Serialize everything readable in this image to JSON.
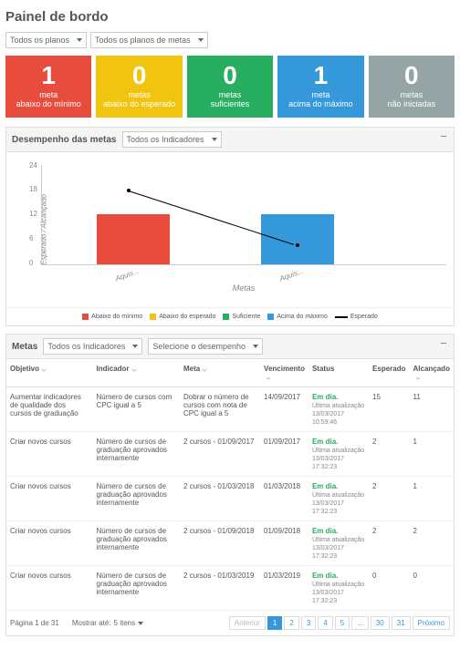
{
  "page_title": "Painel de bordo",
  "top_selects": {
    "plans": "Todos os planos",
    "goal_plans": "Todos os planos de metas"
  },
  "cards": [
    {
      "value": "1",
      "line1": "meta",
      "line2": "abaixo do mínimo",
      "color": "c-red"
    },
    {
      "value": "0",
      "line1": "metas",
      "line2": "abaixo do esperado",
      "color": "c-yellow"
    },
    {
      "value": "0",
      "line1": "metas",
      "line2": "suficientes",
      "color": "c-green"
    },
    {
      "value": "1",
      "line1": "meta",
      "line2": "acima do máximo",
      "color": "c-blue"
    },
    {
      "value": "0",
      "line1": "metas",
      "line2": "não iniciadas",
      "color": "c-gray"
    }
  ],
  "perf_panel": {
    "title": "Desempenho das metas",
    "select": "Todos os Indicadores",
    "y_axis_label": "Esperado / Alcançado",
    "x_axis_label": "Metas",
    "x_cat1": "Aquis...",
    "x_cat2": "Aquis...",
    "legend": {
      "below_min": "Abaixo do mínimo",
      "below_exp": "Abaixo do esperado",
      "sufficient": "Suficiente",
      "above_max": "Acima do máximo",
      "expected": "Esperado"
    }
  },
  "chart_data": {
    "type": "bar",
    "categories": [
      "Aquis...",
      "Aquis..."
    ],
    "series": [
      {
        "name": "Abaixo do mínimo",
        "values": [
          11,
          0
        ],
        "color": "#E74C3C"
      },
      {
        "name": "Abaixo do esperado",
        "values": [
          0,
          0
        ],
        "color": "#F1C40F"
      },
      {
        "name": "Suficiente",
        "values": [
          0,
          0
        ],
        "color": "#27AE60"
      },
      {
        "name": "Acima do máximo",
        "values": [
          0,
          11
        ],
        "color": "#3498DB"
      }
    ],
    "expected_line": {
      "name": "Esperado",
      "values": [
        17,
        4
      ]
    },
    "ylabel": "Esperado / Alcançado",
    "xlabel": "Metas",
    "ylim": [
      0,
      24
    ],
    "yticks": [
      0,
      6,
      12,
      18,
      24
    ]
  },
  "metas_panel": {
    "title": "Metas",
    "sel1": "Todos os Indicadores",
    "sel2": "Selecione o desempenho",
    "columns": {
      "objetivo": "Objetivo",
      "indicador": "Indicador",
      "meta": "Meta",
      "vencimento": "Vencimento",
      "status": "Status",
      "esperado": "Esperado",
      "alcancado": "Alcançado"
    },
    "rows": [
      {
        "objetivo": "Aumentar indicadores de qualidade dos cursos de graduação",
        "indicador": "Número de cursos com CPC igual a 5",
        "meta": "Dobrar o número de cursos com nota de CPC igual a 5",
        "vencimento": "14/09/2017",
        "status": "Em dia.",
        "status_sub": "Última atualização 13/03/2017 10:59:46",
        "esperado": "15",
        "alcancado": "11"
      },
      {
        "objetivo": "Criar novos cursos",
        "indicador": "Número de cursos de graduação aprovados internamente",
        "meta": "2 cursos - 01/09/2017",
        "vencimento": "01/09/2017",
        "status": "Em dia.",
        "status_sub": "Última atualização 13/03/2017 17:32:23",
        "esperado": "2",
        "alcancado": "1"
      },
      {
        "objetivo": "Criar novos cursos",
        "indicador": "Número de cursos de graduação aprovados internamente",
        "meta": "2 cursos - 01/03/2018",
        "vencimento": "01/03/2018",
        "status": "Em dia.",
        "status_sub": "Última atualização 13/03/2017 17:32:23",
        "esperado": "2",
        "alcancado": "1"
      },
      {
        "objetivo": "Criar novos cursos",
        "indicador": "Número de cursos de graduação aprovados internamente",
        "meta": "2 cursos - 01/09/2018",
        "vencimento": "01/09/2018",
        "status": "Em dia.",
        "status_sub": "Última atualização 13/03/2017 17:32:23",
        "esperado": "2",
        "alcancado": "2"
      },
      {
        "objetivo": "Criar novos cursos",
        "indicador": "Número de cursos de graduação aprovados internamente",
        "meta": "2 cursos - 01/03/2019",
        "vencimento": "01/03/2019",
        "status": "Em dia.",
        "status_sub": "Última atualização 13/03/2017 17:32:23",
        "esperado": "0",
        "alcancado": "0"
      }
    ]
  },
  "footer": {
    "page_info": "Página 1 de 31",
    "show_label": "Mostrar até:",
    "show_value": "5 itens",
    "prev": "Anterior",
    "next": "Próximo",
    "pages": [
      "1",
      "2",
      "3",
      "4",
      "5",
      "...",
      "30",
      "31"
    ]
  }
}
